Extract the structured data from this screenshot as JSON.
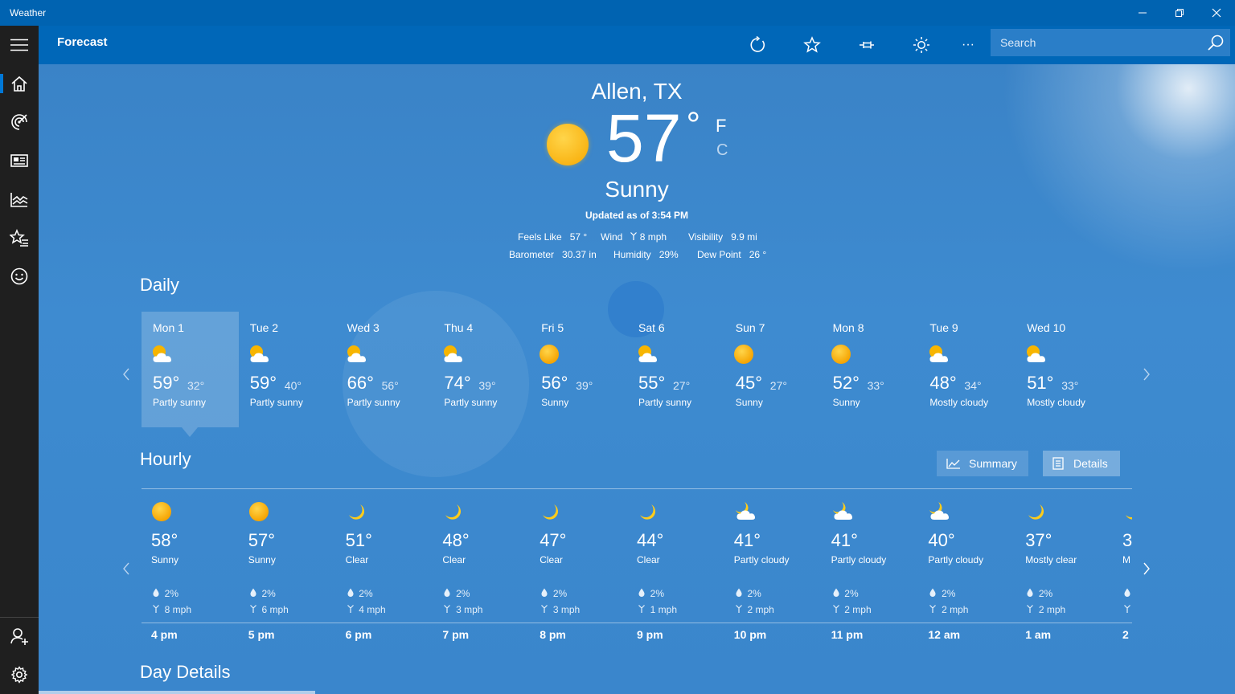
{
  "window": {
    "title": "Weather",
    "minimize": "–",
    "restore": "❐",
    "close": "✕"
  },
  "header": {
    "title": "Forecast",
    "search_placeholder": "Search",
    "more": "···"
  },
  "current": {
    "location": "Allen, TX",
    "temp": "57",
    "degree": "°",
    "unit_f": "F",
    "unit_c": "C",
    "condition": "Sunny",
    "updated": "Updated as of 3:54 PM",
    "stats": {
      "feels_label": "Feels Like",
      "feels_value": "57 °",
      "wind_label": "Wind",
      "wind_value": "8 mph",
      "visibility_label": "Visibility",
      "visibility_value": "9.9 mi",
      "barometer_label": "Barometer",
      "barometer_value": "30.37 in",
      "humidity_label": "Humidity",
      "humidity_value": "29%",
      "dewpoint_label": "Dew Point",
      "dewpoint_value": "26 °"
    }
  },
  "daily": {
    "title": "Daily",
    "days": [
      {
        "name": "Mon 1",
        "hi": "59°",
        "lo": "32°",
        "cond": "Partly sunny",
        "icon": "partly-sunny"
      },
      {
        "name": "Tue 2",
        "hi": "59°",
        "lo": "40°",
        "cond": "Partly sunny",
        "icon": "partly-sunny"
      },
      {
        "name": "Wed 3",
        "hi": "66°",
        "lo": "56°",
        "cond": "Partly sunny",
        "icon": "partly-sunny"
      },
      {
        "name": "Thu 4",
        "hi": "74°",
        "lo": "39°",
        "cond": "Partly sunny",
        "icon": "partly-sunny"
      },
      {
        "name": "Fri 5",
        "hi": "56°",
        "lo": "39°",
        "cond": "Sunny",
        "icon": "sunny"
      },
      {
        "name": "Sat 6",
        "hi": "55°",
        "lo": "27°",
        "cond": "Partly sunny",
        "icon": "partly-sunny"
      },
      {
        "name": "Sun 7",
        "hi": "45°",
        "lo": "27°",
        "cond": "Sunny",
        "icon": "sunny"
      },
      {
        "name": "Mon 8",
        "hi": "52°",
        "lo": "33°",
        "cond": "Sunny",
        "icon": "sunny"
      },
      {
        "name": "Tue 9",
        "hi": "48°",
        "lo": "34°",
        "cond": "Mostly cloudy",
        "icon": "partly-sunny"
      },
      {
        "name": "Wed 10",
        "hi": "51°",
        "lo": "33°",
        "cond": "Mostly cloudy",
        "icon": "partly-sunny"
      }
    ]
  },
  "hourly": {
    "title": "Hourly",
    "summary_label": "Summary",
    "details_label": "Details",
    "hours": [
      {
        "temp": "58°",
        "cond": "Sunny",
        "precip": "2%",
        "wind": "8 mph",
        "time": "4 pm",
        "icon": "sunny"
      },
      {
        "temp": "57°",
        "cond": "Sunny",
        "precip": "2%",
        "wind": "6 mph",
        "time": "5 pm",
        "icon": "sunny"
      },
      {
        "temp": "51°",
        "cond": "Clear",
        "precip": "2%",
        "wind": "4 mph",
        "time": "6 pm",
        "icon": "moon"
      },
      {
        "temp": "48°",
        "cond": "Clear",
        "precip": "2%",
        "wind": "3 mph",
        "time": "7 pm",
        "icon": "moon"
      },
      {
        "temp": "47°",
        "cond": "Clear",
        "precip": "2%",
        "wind": "3 mph",
        "time": "8 pm",
        "icon": "moon"
      },
      {
        "temp": "44°",
        "cond": "Clear",
        "precip": "2%",
        "wind": "1 mph",
        "time": "9 pm",
        "icon": "moon"
      },
      {
        "temp": "41°",
        "cond": "Partly cloudy",
        "precip": "2%",
        "wind": "2 mph",
        "time": "10 pm",
        "icon": "moon-cloud"
      },
      {
        "temp": "41°",
        "cond": "Partly cloudy",
        "precip": "2%",
        "wind": "2 mph",
        "time": "11 pm",
        "icon": "moon-cloud"
      },
      {
        "temp": "40°",
        "cond": "Partly cloudy",
        "precip": "2%",
        "wind": "2 mph",
        "time": "12 am",
        "icon": "moon-cloud"
      },
      {
        "temp": "37°",
        "cond": "Mostly clear",
        "precip": "2%",
        "wind": "2 mph",
        "time": "1 am",
        "icon": "moon"
      },
      {
        "temp": "3",
        "cond": "M",
        "precip": "",
        "wind": "",
        "time": "2",
        "icon": "moon"
      }
    ]
  },
  "day_details": {
    "title": "Day Details"
  },
  "colors": {
    "titlebar": "#0063b1",
    "header": "#0067b8",
    "sidebar": "#1f1f1f",
    "sun": "#f7a800",
    "accent": "#0078d7"
  }
}
